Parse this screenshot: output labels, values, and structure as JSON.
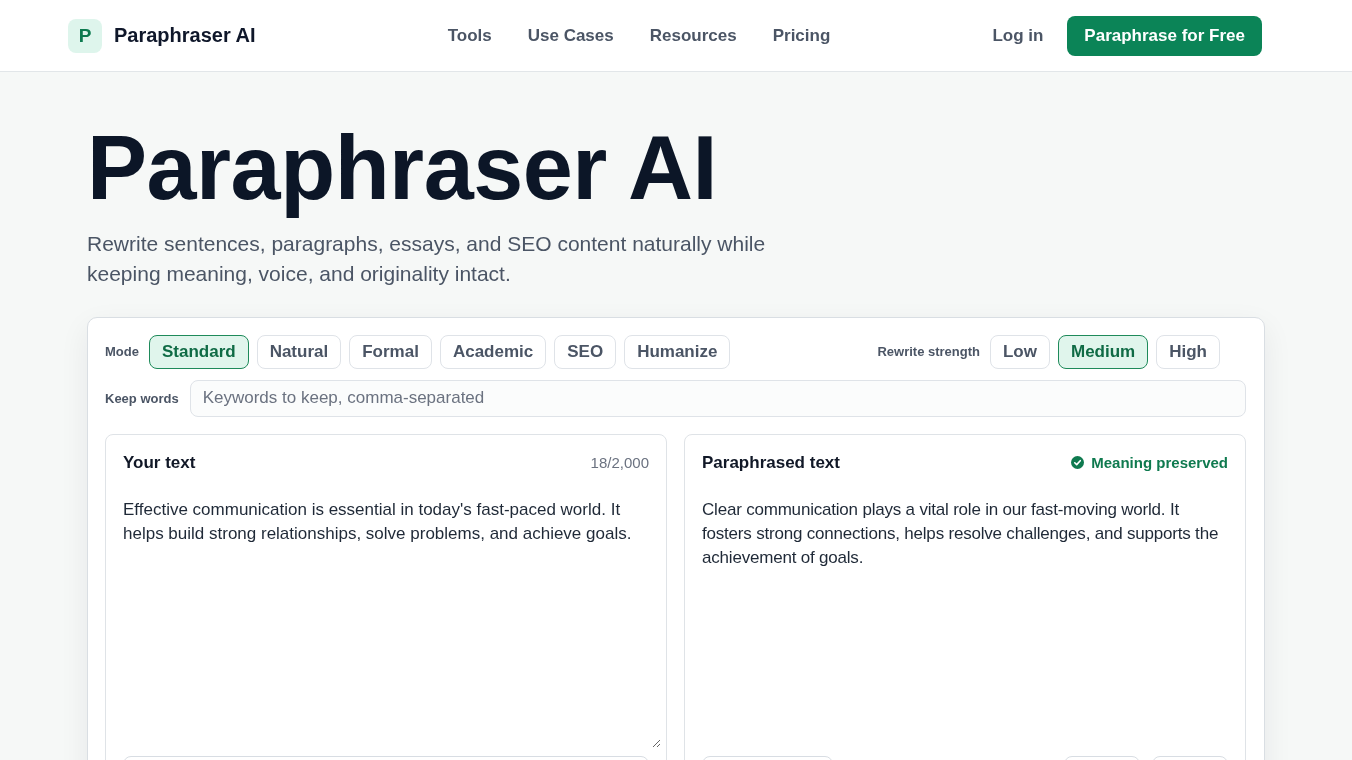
{
  "header": {
    "logo": {
      "mark": "P",
      "name": "Paraphraser AI"
    },
    "nav": [
      "Tools",
      "Use Cases",
      "Resources",
      "Pricing"
    ],
    "login": "Log in",
    "cta": "Paraphrase for Free"
  },
  "hero": {
    "title": "Paraphraser AI",
    "subtitle": "Rewrite sentences, paragraphs, essays, and SEO content naturally while keeping meaning, voice, and originality intact."
  },
  "editor": {
    "mode": {
      "label": "Mode",
      "options": [
        {
          "label": "Standard",
          "selected": true
        },
        {
          "label": "Natural",
          "selected": false
        },
        {
          "label": "Formal",
          "selected": false
        },
        {
          "label": "Academic",
          "selected": false
        },
        {
          "label": "SEO",
          "selected": false
        },
        {
          "label": "Humanize",
          "selected": false
        }
      ]
    },
    "strength": {
      "label": "Rewrite strength",
      "options": [
        {
          "label": "Low",
          "selected": false
        },
        {
          "label": "Medium",
          "selected": true
        },
        {
          "label": "High",
          "selected": false
        }
      ]
    },
    "keep_words": {
      "label": "Keep words",
      "placeholder": "Keywords to keep, comma-separated"
    },
    "panels": [
      {
        "kind": "input",
        "title": "Your text",
        "counter": "18/2,000",
        "text": "Effective communication is essential in today's fast-paced world. It helps build strong relationships, solve problems, and achieve goals.",
        "actions": {
          "start": [
            {
              "kind": "bar"
            }
          ]
        }
      },
      {
        "kind": "output",
        "title": "Paraphrased text",
        "status": "Meaning preserved",
        "text": "Clear communication plays a vital role in our fast-moving world. It fosters strong connections, helps resolve challenges, and supports the achievement of goals.",
        "actions": {
          "start": [
            {
              "kind": "button"
            }
          ],
          "end": [
            {
              "kind": "button"
            },
            {
              "kind": "button"
            }
          ]
        }
      }
    ]
  }
}
